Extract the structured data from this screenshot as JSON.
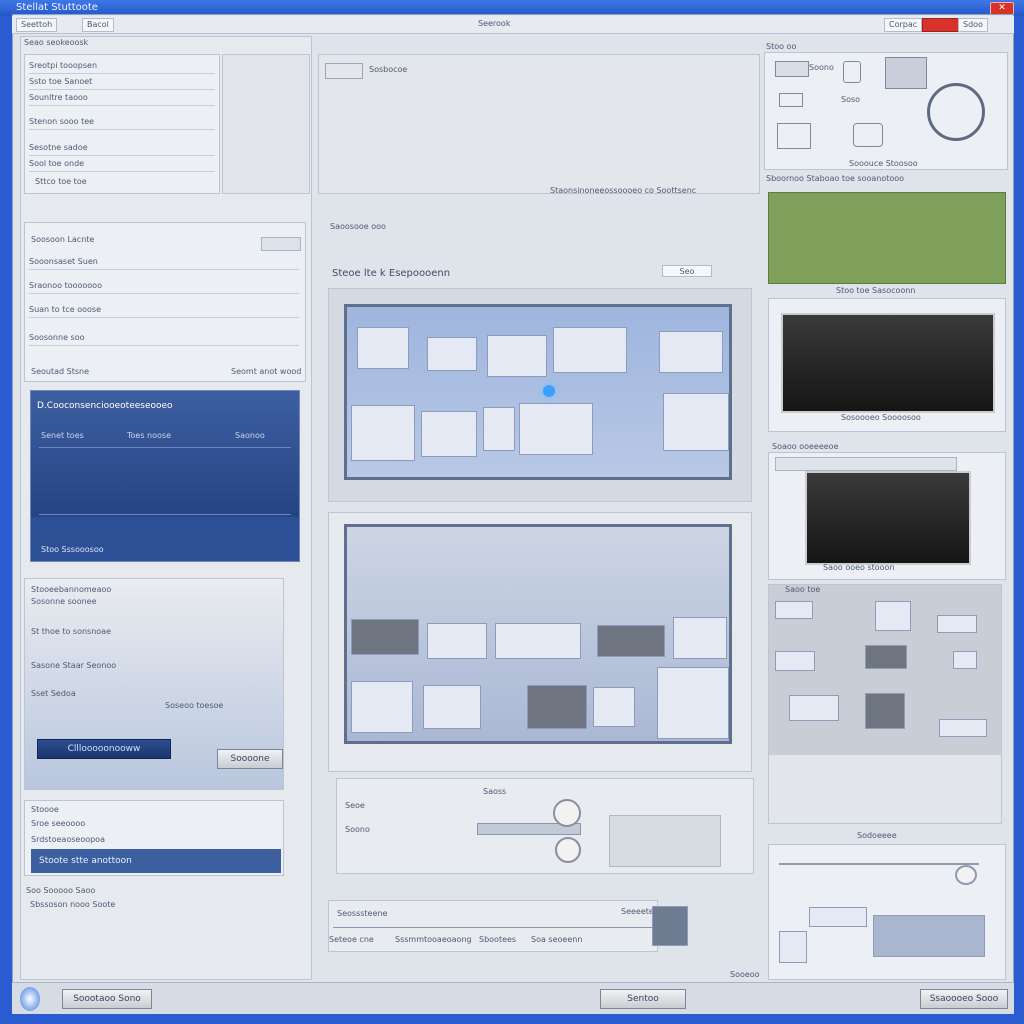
{
  "window": {
    "title": "Stellat Stuttoote",
    "close_label": "✕"
  },
  "toolbar": {
    "items": [
      "Seettoh",
      "Bacol"
    ],
    "center_label": "Seerook",
    "right_items": [
      "Corpac",
      "Sdoo"
    ]
  },
  "left": {
    "header": "Seao seokeoosk",
    "list1": [
      "Sreotpi tooopsen",
      "Ssto toe Sanoet",
      "Sounltre taooo",
      "Stenon sooo tee",
      "Sesotne sadoe",
      "Sool toe onde"
    ],
    "list1_footer": "Sttco toe toe",
    "group2_header": "Soosoon Lacnte",
    "group2_caption": "Seomt anot wood",
    "list2": [
      "Sooonsaset Suen",
      "Sraonoo tooooooo",
      "Suan to tce ooose",
      "Soosonne soo"
    ],
    "group2_footer": "Seoutad Stsne",
    "blue_title": "D.Cooconsenciooeoteeseooeo",
    "blue_columns": [
      "Senet toes",
      "Toes noose",
      "Saonoo"
    ],
    "blue_footer": "Stoo Sssooosoo",
    "group3": [
      "Stooeebannomeaoo",
      "Sosonne soonee",
      "St thoe to sonsnoae",
      "Sasone Staar Seonoo",
      "Sset Sedoa",
      "Soseoo toesoe"
    ],
    "dark_button": "Clllooooonooww",
    "small_button": "Soooone",
    "group4": [
      "Stoooe",
      "Sroe seeoooo",
      "Srdstoeaoseoopoa"
    ],
    "banner": "Stoote stte anottoon",
    "footer": [
      "Soo Sooooo Saoo",
      "Sbssoson nooo Soote"
    ]
  },
  "center": {
    "top_label": "Sosbocoe",
    "caption1": "Staonsinoneeossoooeo co Soottsenc",
    "section_label": "Saoosooe ooo",
    "heading": "Steoe lte k Esepoooenn",
    "heading_button": "Seo",
    "mid_labels": [
      "Seoe",
      "Soono",
      "Saoss"
    ],
    "timeline_title": "Seosssteene",
    "timeline_items": [
      "Seteoe cne",
      "Sssmmtooaeoaong",
      "Sbootees",
      "Soa seoeenn",
      "Seeeete"
    ]
  },
  "right": {
    "header": "Stoo oo",
    "icon_labels": [
      "Soono",
      "Soso"
    ],
    "caption1": "Sooouce Stoosoo",
    "caption2": "Sboornoo Staboao toe sooanotooo",
    "caption3": "Stoo toe Sasocoonn",
    "caption4": "Sosoooeo Soooosoo",
    "caption5": "Soaoo ooeeeeoe",
    "caption6": "Saoo ooeo stooon",
    "caption7": "Saoo toe",
    "caption8": "Sodoeeee",
    "footer": "Sooeoo"
  },
  "status": {
    "left_button": "Soootaoo Sono",
    "center_button": "Sentoo",
    "right_button": "Ssaoooeo Sooo"
  }
}
